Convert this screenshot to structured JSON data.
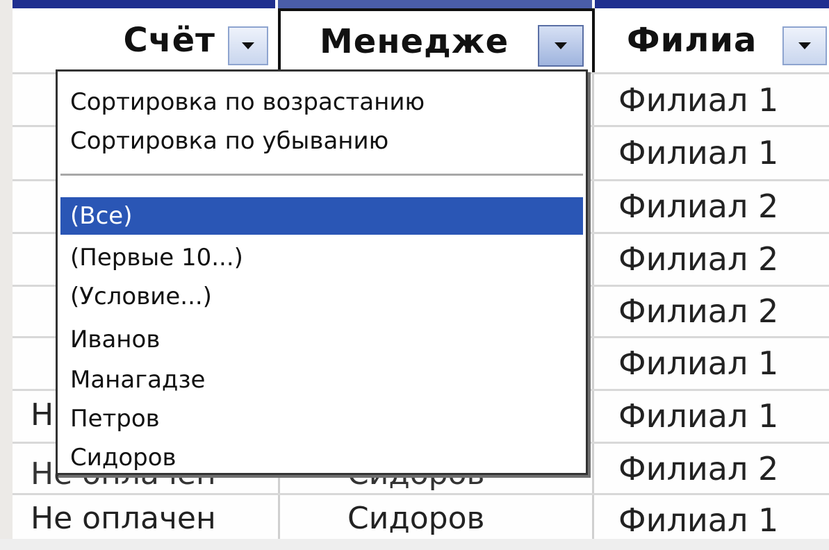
{
  "header": {
    "col1": "Счёт",
    "col2": "Менедже",
    "col3": "Филиа"
  },
  "branch_column": [
    "Филиал 1",
    "Филиал 1",
    "Филиал 2",
    "Филиал 2",
    "Филиал 2",
    "Филиал 1",
    "Филиал 1",
    "Филиал 2",
    "Филиал 1"
  ],
  "rows_visible": [
    {
      "status": "Не оплачен",
      "manager": "Сидоров"
    },
    {
      "status": "Не оплачен",
      "manager": "Сидоров"
    }
  ],
  "partial_text": "Н",
  "filter_menu": {
    "sort_asc": "Сортировка по возрастанию",
    "sort_desc": "Сортировка по убыванию",
    "all": "(Все)",
    "top10": "(Первые 10...)",
    "condition": "(Условие...)",
    "items": [
      "Иванов",
      "Манагадзе",
      "Петров",
      "Сидоров"
    ]
  },
  "colors": {
    "selection": "#2a56b5",
    "top_border": "#1f2f8f"
  }
}
